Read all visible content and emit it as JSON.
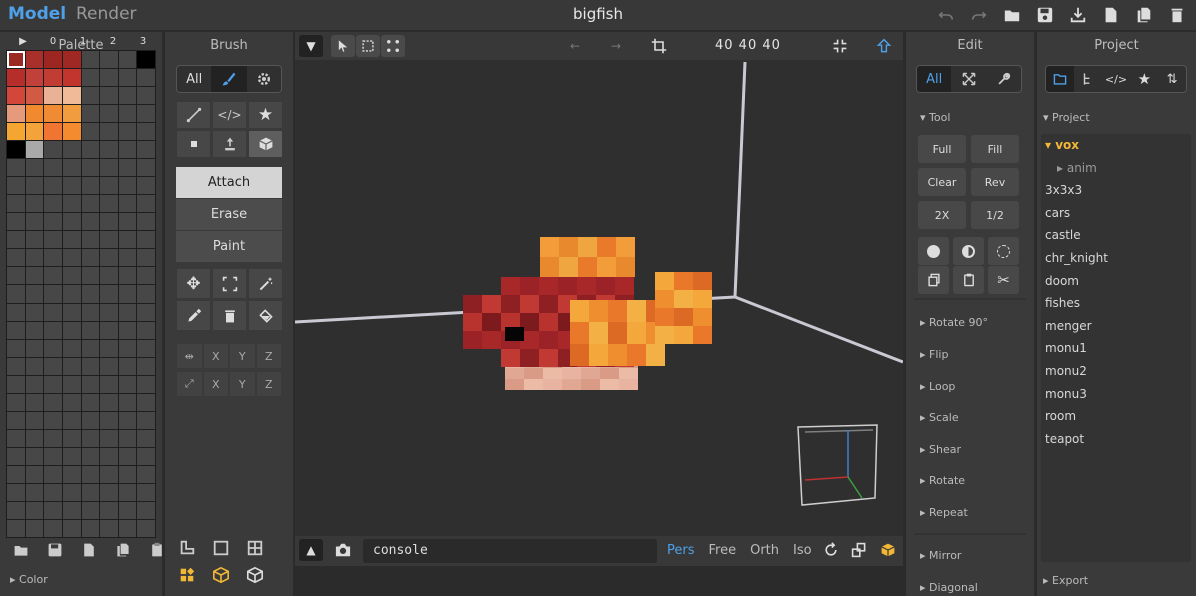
{
  "app": {
    "tab_model": "Model",
    "tab_render": "Render",
    "title": "bigfish"
  },
  "palette": {
    "title": "Palette",
    "headers": [
      "▶",
      "0",
      "1",
      "2",
      "3"
    ],
    "color_section": "▸ Color",
    "colors": [
      [
        "#ffffff",
        "#a9302a",
        "#9d2623",
        "#9f2724",
        "#474747",
        "#474747",
        "#474747",
        "#000000"
      ],
      [
        "#b62d29",
        "#c2403a",
        "#c13d33",
        "#c1352e",
        "#474747",
        "#474747",
        "#474747",
        "#474747"
      ],
      [
        "#d3473b",
        "#d25a44",
        "#e9b196",
        "#f0ba99",
        "#474747",
        "#474747",
        "#474747",
        "#474747"
      ],
      [
        "#e59a7c",
        "#f1892e",
        "#ef8b33",
        "#f29c40",
        "#474747",
        "#474747",
        "#474747",
        "#474747"
      ],
      [
        "#f4a532",
        "#f3a33a",
        "#f07532",
        "#f58b2f",
        "#474747",
        "#474747",
        "#474747",
        "#474747"
      ],
      [
        "#000000",
        "#a9a9a9",
        "#474747",
        "#474747",
        "#474747",
        "#474747",
        "#474747",
        "#474747"
      ]
    ]
  },
  "brush": {
    "title": "Brush",
    "filter_all": "All",
    "modes": [
      "Attach",
      "Erase",
      "Paint"
    ],
    "axes": [
      "X",
      "Y",
      "Z"
    ]
  },
  "viewport": {
    "dims": "40  40  40",
    "console_placeholder": "console",
    "views": [
      "Pers",
      "Free",
      "Orth",
      "Iso"
    ],
    "active_view": "Pers"
  },
  "edit": {
    "title": "Edit",
    "filter_all": "All",
    "tool_section": "Tool",
    "tool_buttons": [
      "Full",
      "Fill",
      "Clear",
      "Rev",
      "2X",
      "1/2"
    ],
    "sections": [
      "Rotate 90°",
      "Flip",
      "Loop",
      "Scale",
      "Shear",
      "Rotate",
      "Repeat",
      "Mirror",
      "Diagonal"
    ]
  },
  "project": {
    "title": "Project",
    "section": "Project",
    "root": "vox",
    "sub": "anim",
    "files": [
      "3x3x3",
      "cars",
      "castle",
      "chr_knight",
      "doom",
      "fishes",
      "menger",
      "monu1",
      "monu2",
      "monu3",
      "room",
      "teapot"
    ],
    "export": "Export"
  },
  "colors": {
    "accent": "#4fa0e8",
    "selected_folder": "#f2b736",
    "panel": "#3a3a3a",
    "viewport": "#2f2f2f"
  }
}
